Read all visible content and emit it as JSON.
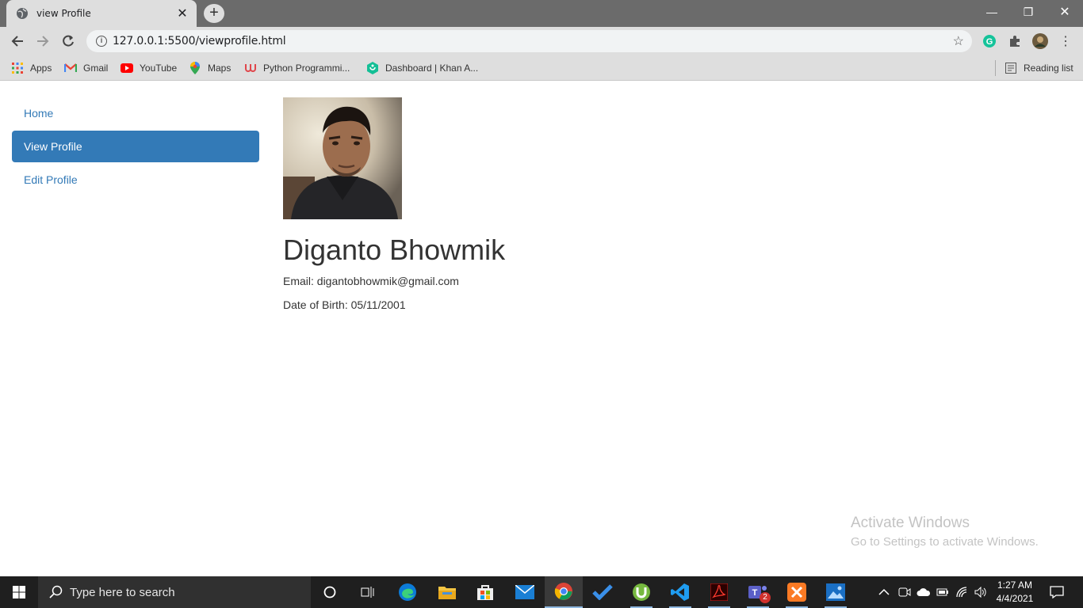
{
  "browser": {
    "tab_title": "view Profile",
    "url": "127.0.0.1:5500/viewprofile.html",
    "bookmarks": [
      {
        "label": "Apps",
        "icon": "apps-grid-icon"
      },
      {
        "label": "Gmail",
        "icon": "gmail-icon"
      },
      {
        "label": "YouTube",
        "icon": "youtube-icon"
      },
      {
        "label": "Maps",
        "icon": "maps-pin-icon"
      },
      {
        "label": "Python Programmi...",
        "icon": "python-udemy-icon"
      },
      {
        "label": "Dashboard | Khan A...",
        "icon": "khan-academy-icon"
      }
    ],
    "reading_list": "Reading list"
  },
  "sidebar": {
    "items": [
      {
        "label": "Home",
        "active": false
      },
      {
        "label": "View Profile",
        "active": true
      },
      {
        "label": "Edit Profile",
        "active": false
      }
    ]
  },
  "profile": {
    "name": "Diganto Bhowmik",
    "email_line": "Email: digantobhowmik@gmail.com",
    "dob_line": "Date of Birth: 05/11/2001"
  },
  "watermark": {
    "line1": "Activate Windows",
    "line2": "Go to Settings to activate Windows."
  },
  "taskbar": {
    "search_placeholder": "Type here to search",
    "time": "1:27 AM",
    "date": "4/4/2021",
    "teams_badge": "2"
  },
  "colors": {
    "accent": "#337ab7",
    "tabstrip": "#6b6b6b",
    "toolbar": "#dedede",
    "taskbar": "#1f1f1f"
  }
}
